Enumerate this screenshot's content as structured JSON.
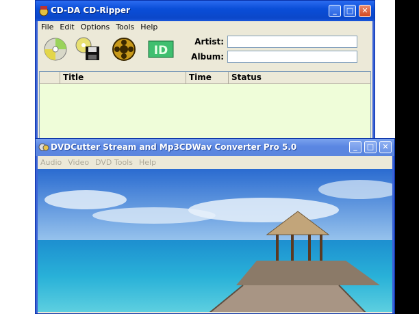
{
  "window1": {
    "title": "CD-DA CD-Ripper",
    "menu": [
      "File",
      "Edit",
      "Options",
      "Tools",
      "Help"
    ],
    "artist_label": "Artist:",
    "album_label": "Album:",
    "artist_value": "",
    "album_value": "",
    "columns": [
      "Title",
      "Time",
      "Status"
    ],
    "toolbar_icons": [
      "cd-read-icon",
      "cd-save-icon",
      "film-reel-icon",
      "id3-tag-icon"
    ]
  },
  "window2": {
    "title": "DVDCutter Stream and Mp3CDWav Converter Pro 5.0",
    "menu": [
      "Audio",
      "Video",
      "DVD Tools",
      "Help"
    ],
    "video_content": "tropical beach pier with thatched gazebo"
  },
  "colors": {
    "titlebar_active": "#0a4ed8",
    "titlebar_inactive": "#7aa2ee",
    "list_bg": "#effdd9",
    "close_button": "#d3471f"
  }
}
